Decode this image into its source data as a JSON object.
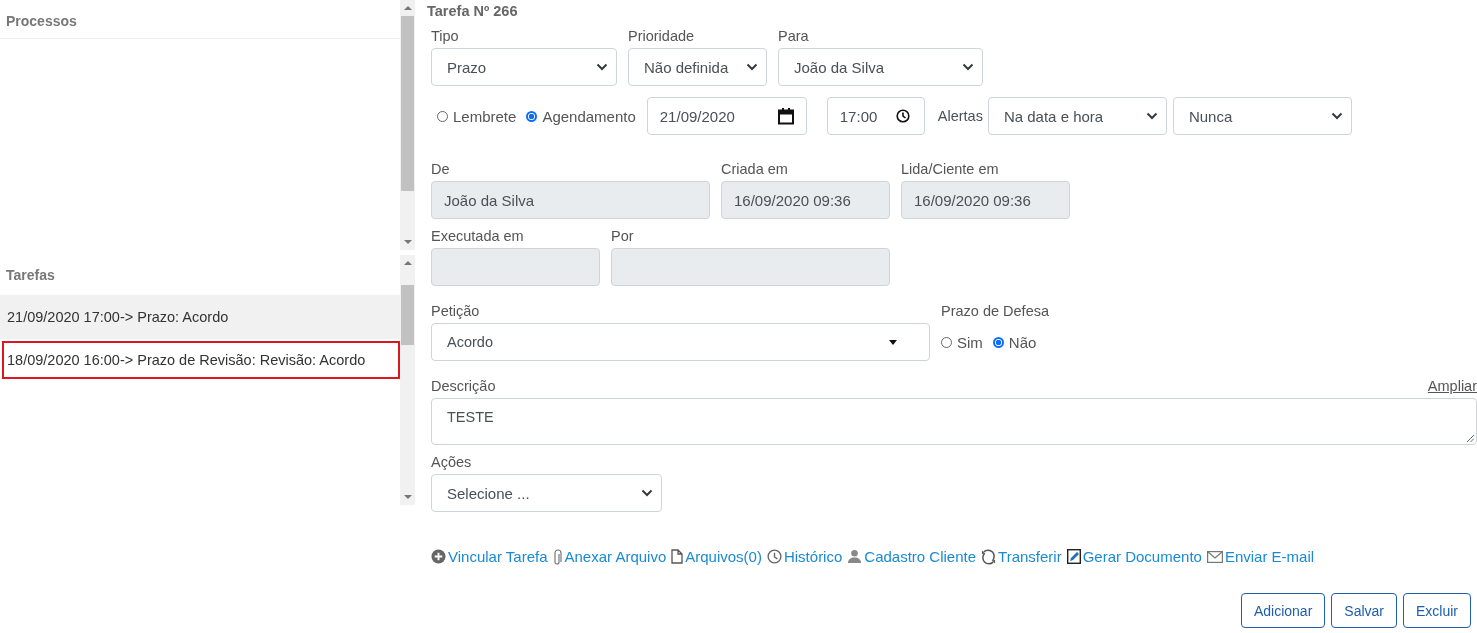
{
  "sidebar": {
    "processes_heading": "Processos",
    "tasks_heading": "Tarefas",
    "tasks": [
      {
        "label": "21/09/2020 17:00-> Prazo: Acordo",
        "highlighted": true,
        "selected": false
      },
      {
        "label": "18/09/2020 16:00-> Prazo de Revisão: Revisão: Acordo",
        "highlighted": false,
        "selected": true
      }
    ]
  },
  "form": {
    "title": "Tarefa Nº 266",
    "selects": [
      {
        "label": "Tipo",
        "value": "Prazo"
      },
      {
        "label": "Prioridade",
        "value": "Não definida"
      },
      {
        "label": "Para",
        "value": "João da Silva"
      }
    ],
    "mode": [
      {
        "label": "Lembrete",
        "selected": false
      },
      {
        "label": "Agendamento",
        "selected": true
      }
    ],
    "date": "21/09/2020",
    "time": "17:00",
    "alerts_label": "Alertas",
    "alerts": [
      "Na data e hora",
      "Nunca"
    ],
    "info": [
      {
        "label": "De",
        "value": "João da Silva"
      },
      {
        "label": "Criada em",
        "value": "16/09/2020 09:36"
      },
      {
        "label": "Lida/Ciente em",
        "value": "16/09/2020 09:36"
      }
    ],
    "executed": [
      {
        "label": "Executada em"
      },
      {
        "label": "Por"
      }
    ],
    "petition": {
      "label": "Petição",
      "value": "Acordo"
    },
    "defense": {
      "label": "Prazo de Defesa",
      "options": [
        {
          "label": "Sim",
          "selected": false
        },
        {
          "label": "Não",
          "selected": true
        }
      ]
    },
    "description": {
      "label": "Descrição",
      "expand_link": "Ampliar",
      "value": "TESTE"
    },
    "actions": {
      "label": "Ações",
      "value": "Selecione ..."
    },
    "links": [
      {
        "kind": "plus",
        "label": "Vincular Tarefa"
      },
      {
        "kind": "clip",
        "label": "Anexar Arquivo"
      },
      {
        "kind": "file",
        "label": "Arquivos(0)"
      },
      {
        "kind": "clock",
        "label": "Histórico"
      },
      {
        "kind": "person",
        "label": "Cadastro Cliente"
      },
      {
        "kind": "refresh",
        "label": "Transferir"
      },
      {
        "kind": "edit",
        "label": "Gerar Documento"
      },
      {
        "kind": "mail",
        "label": "Enviar E-mail"
      }
    ],
    "buttons": [
      "Adicionar",
      "Salvar",
      "Excluir"
    ]
  }
}
